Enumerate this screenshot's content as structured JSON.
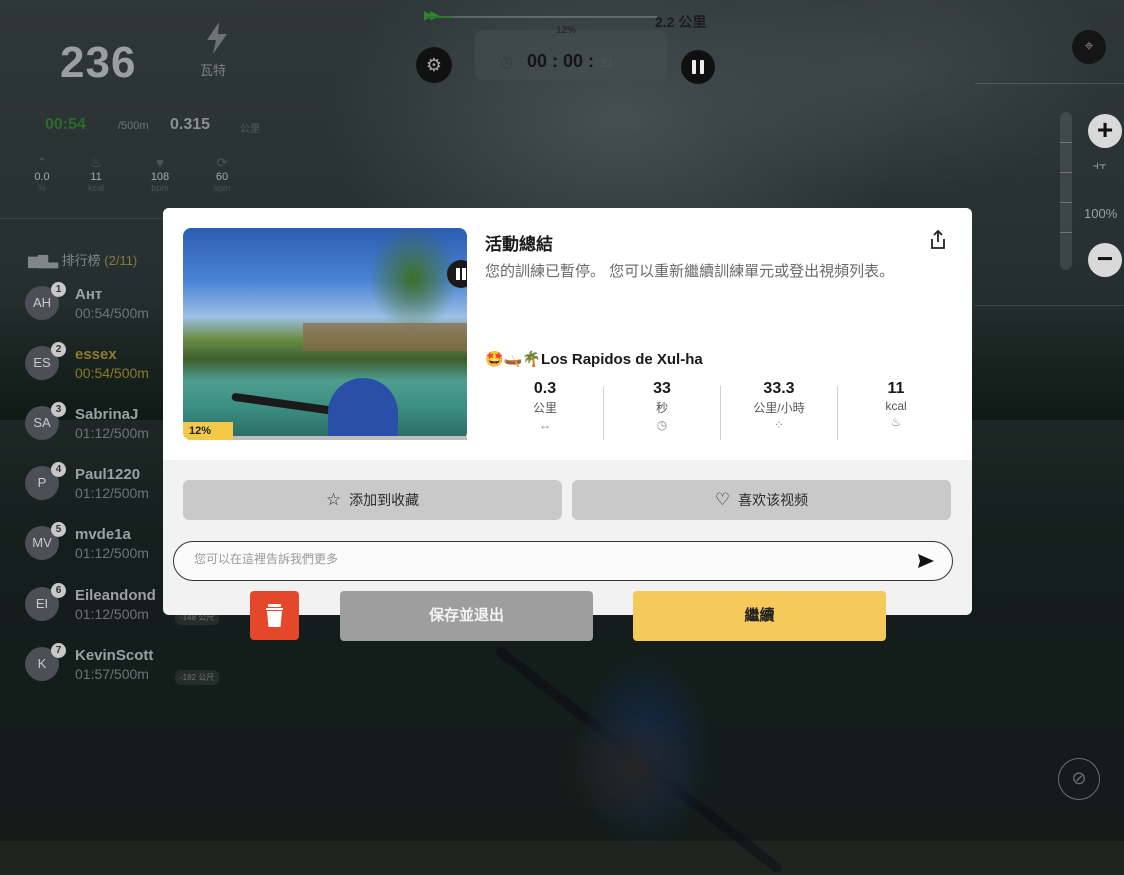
{
  "hud": {
    "power_value": "236",
    "power_unit": "瓦特",
    "split_time": "00:54",
    "split_unit": "/500m",
    "distance_value": "0.315",
    "distance_unit": "公里",
    "mini_stats": [
      {
        "icon": "incline-icon",
        "value": "0.0",
        "unit": "%"
      },
      {
        "icon": "flame-icon",
        "value": "11",
        "unit": "kcal"
      },
      {
        "icon": "heart-icon",
        "value": "108",
        "unit": "bpm"
      },
      {
        "icon": "cadence-icon",
        "value": "60",
        "unit": "spm"
      }
    ]
  },
  "topbar": {
    "progress_percent": "12%",
    "progress_fraction": 0.12,
    "total_distance": "2.2 公里",
    "timer": "00 : 00 :",
    "timer_seconds": "33"
  },
  "leaderboard": {
    "title": "排行榜",
    "count": "(2/11)",
    "rows": [
      {
        "rank": "1",
        "initials": "AH",
        "name": "Aнт",
        "time": "00:54/500m",
        "dist": ""
      },
      {
        "rank": "2",
        "initials": "ES",
        "name": "essex",
        "time": "00:54/500m",
        "dist": "",
        "highlight": true
      },
      {
        "rank": "3",
        "initials": "SA",
        "name": "SabrinaJ",
        "time": "01:12/500m",
        "dist": ""
      },
      {
        "rank": "4",
        "initials": "P",
        "name": "Paul1220",
        "time": "01:12/500m",
        "dist": ""
      },
      {
        "rank": "5",
        "initials": "MV",
        "name": "mvde1a",
        "time": "01:12/500m",
        "dist": ""
      },
      {
        "rank": "6",
        "initials": "EI",
        "name": "Eileandond",
        "time": "01:12/500m",
        "dist": "-148 公尺"
      },
      {
        "rank": "7",
        "initials": "K",
        "name": "KevinScott",
        "time": "01:57/500m",
        "dist": "-182 公尺"
      }
    ]
  },
  "controls": {
    "resistance_percent": "100%"
  },
  "modal": {
    "title": "活動總結",
    "description": "您的訓練已暫停。 您可以重新繼續訓練單元或登出視頻列表。",
    "thumb_progress": "12%",
    "route_emoji": "🤩🛶🌴",
    "route_name": "Los Rapidos de Xul-ha",
    "stats": [
      {
        "value": "0.3",
        "unit": "公里",
        "icon": "distance-icon",
        "glyph": "↔"
      },
      {
        "value": "33",
        "unit": "秒",
        "icon": "clock-icon",
        "glyph": "◷"
      },
      {
        "value": "33.3",
        "unit": "公里/小時",
        "icon": "speed-icon",
        "glyph": "⁘"
      },
      {
        "value": "11",
        "unit": "kcal",
        "icon": "flame-icon",
        "glyph": "♨"
      }
    ],
    "add_favorite_label": "添加到收藏",
    "like_label": "喜欢该视频",
    "feedback_placeholder": "您可以在這裡告訴我們更多",
    "save_exit_label": "保存並退出",
    "continue_label": "繼續"
  },
  "colors": {
    "continue": "#f5c95a",
    "delete": "#e4472a",
    "save": "#9e9e9e"
  }
}
